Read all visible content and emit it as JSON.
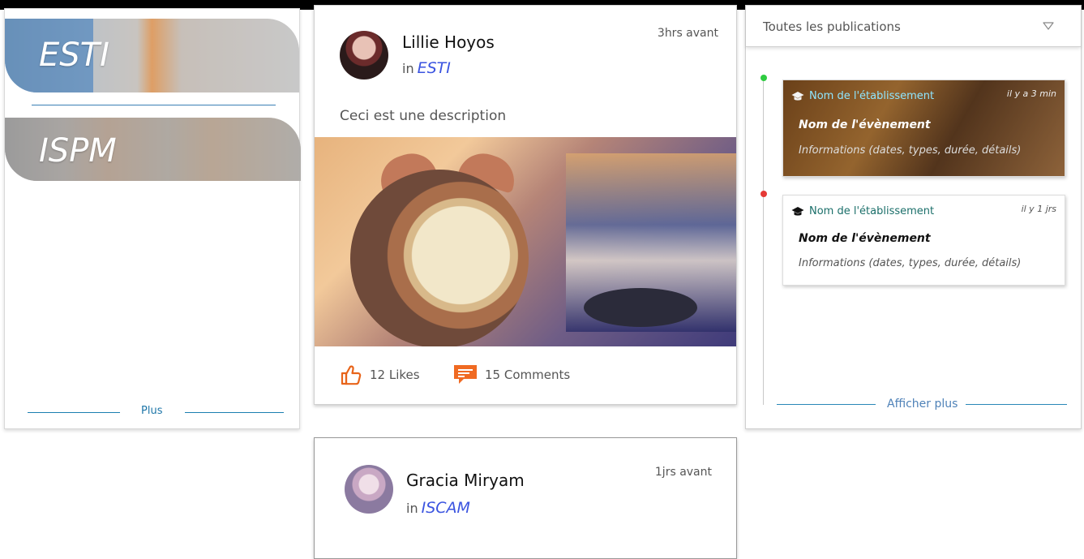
{
  "schools": [
    {
      "name": "ESTI"
    },
    {
      "name": "ISPM"
    }
  ],
  "left": {
    "more_label": "Plus"
  },
  "posts": [
    {
      "author": "Lillie Hoyos",
      "in_prefix": "in",
      "school": "ESTI",
      "time": "3hrs avant",
      "description": "Ceci est une description",
      "likes": "12 Likes",
      "comments": "15 Comments"
    },
    {
      "author": "Gracia Miryam",
      "in_prefix": "in",
      "school": "ISCAM",
      "time": "1jrs avant"
    }
  ],
  "right": {
    "filter_label": "Toutes les publications",
    "events": [
      {
        "institution": "Nom de l'établissement",
        "ago": "il y a 3 min",
        "name": "Nom de l'évènement",
        "info": "Informations (dates, types, durée, détails)"
      },
      {
        "institution": "Nom de l'établissement",
        "ago": "il y 1 jrs",
        "name": "Nom de l'évènement",
        "info": "Informations (dates, types, durée, détails)"
      }
    ],
    "more_label": "Afficher plus"
  },
  "colors": {
    "school_link": "#3b54e0",
    "accent_blue": "#1e76a8",
    "like_orange": "#e8641a",
    "comment_orange": "#f06a22",
    "dot_green": "#2ecc40",
    "dot_red": "#e53935"
  },
  "icons": {
    "like": "thumbs-up-icon",
    "comment": "comment-bubble-icon",
    "graduation": "graduation-cap-icon",
    "dropdown": "chevron-down-icon"
  }
}
